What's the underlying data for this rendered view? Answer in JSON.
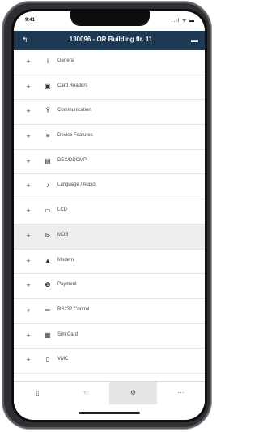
{
  "status_bar": {
    "time": "9:41",
    "indicators": "..ıl ᯤ ▬"
  },
  "header": {
    "back_icon": "↰",
    "title": "130096 - OR Building flr. 11",
    "menu_icon": "▬"
  },
  "list": {
    "expand_glyph": "+",
    "items": [
      {
        "label": "General",
        "icon": "info-icon",
        "glyph": "i"
      },
      {
        "label": "Card Readers",
        "icon": "card-reader-icon",
        "glyph": "▣"
      },
      {
        "label": "Communication",
        "icon": "antenna-icon",
        "glyph": "Ÿ"
      },
      {
        "label": "Device Features",
        "icon": "features-icon",
        "glyph": "≡"
      },
      {
        "label": "DEX/DDCMP",
        "icon": "document-icon",
        "glyph": "▤"
      },
      {
        "label": "Language / Audio",
        "icon": "audio-icon",
        "glyph": "♪"
      },
      {
        "label": "LCD",
        "icon": "screen-icon",
        "glyph": "▭"
      },
      {
        "label": "MDB",
        "icon": "connector-icon",
        "glyph": "⊳"
      },
      {
        "label": "Modem",
        "icon": "modem-icon",
        "glyph": "▲"
      },
      {
        "label": "Payment",
        "icon": "payment-icon",
        "glyph": "❶"
      },
      {
        "label": "RS232 Control",
        "icon": "cable-icon",
        "glyph": "═"
      },
      {
        "label": "Sim Card",
        "icon": "sim-card-icon",
        "glyph": "▦"
      },
      {
        "label": "VMC",
        "icon": "machine-icon",
        "glyph": "▯"
      }
    ],
    "selected_index": 7
  },
  "tabbar": {
    "tabs": [
      {
        "icon": "device-icon",
        "glyph": "▯"
      },
      {
        "icon": "hand-icon",
        "glyph": "☜"
      },
      {
        "icon": "settings-icon",
        "glyph": "⚙"
      },
      {
        "icon": "more-icon",
        "glyph": "···"
      }
    ],
    "active_index": 2
  }
}
